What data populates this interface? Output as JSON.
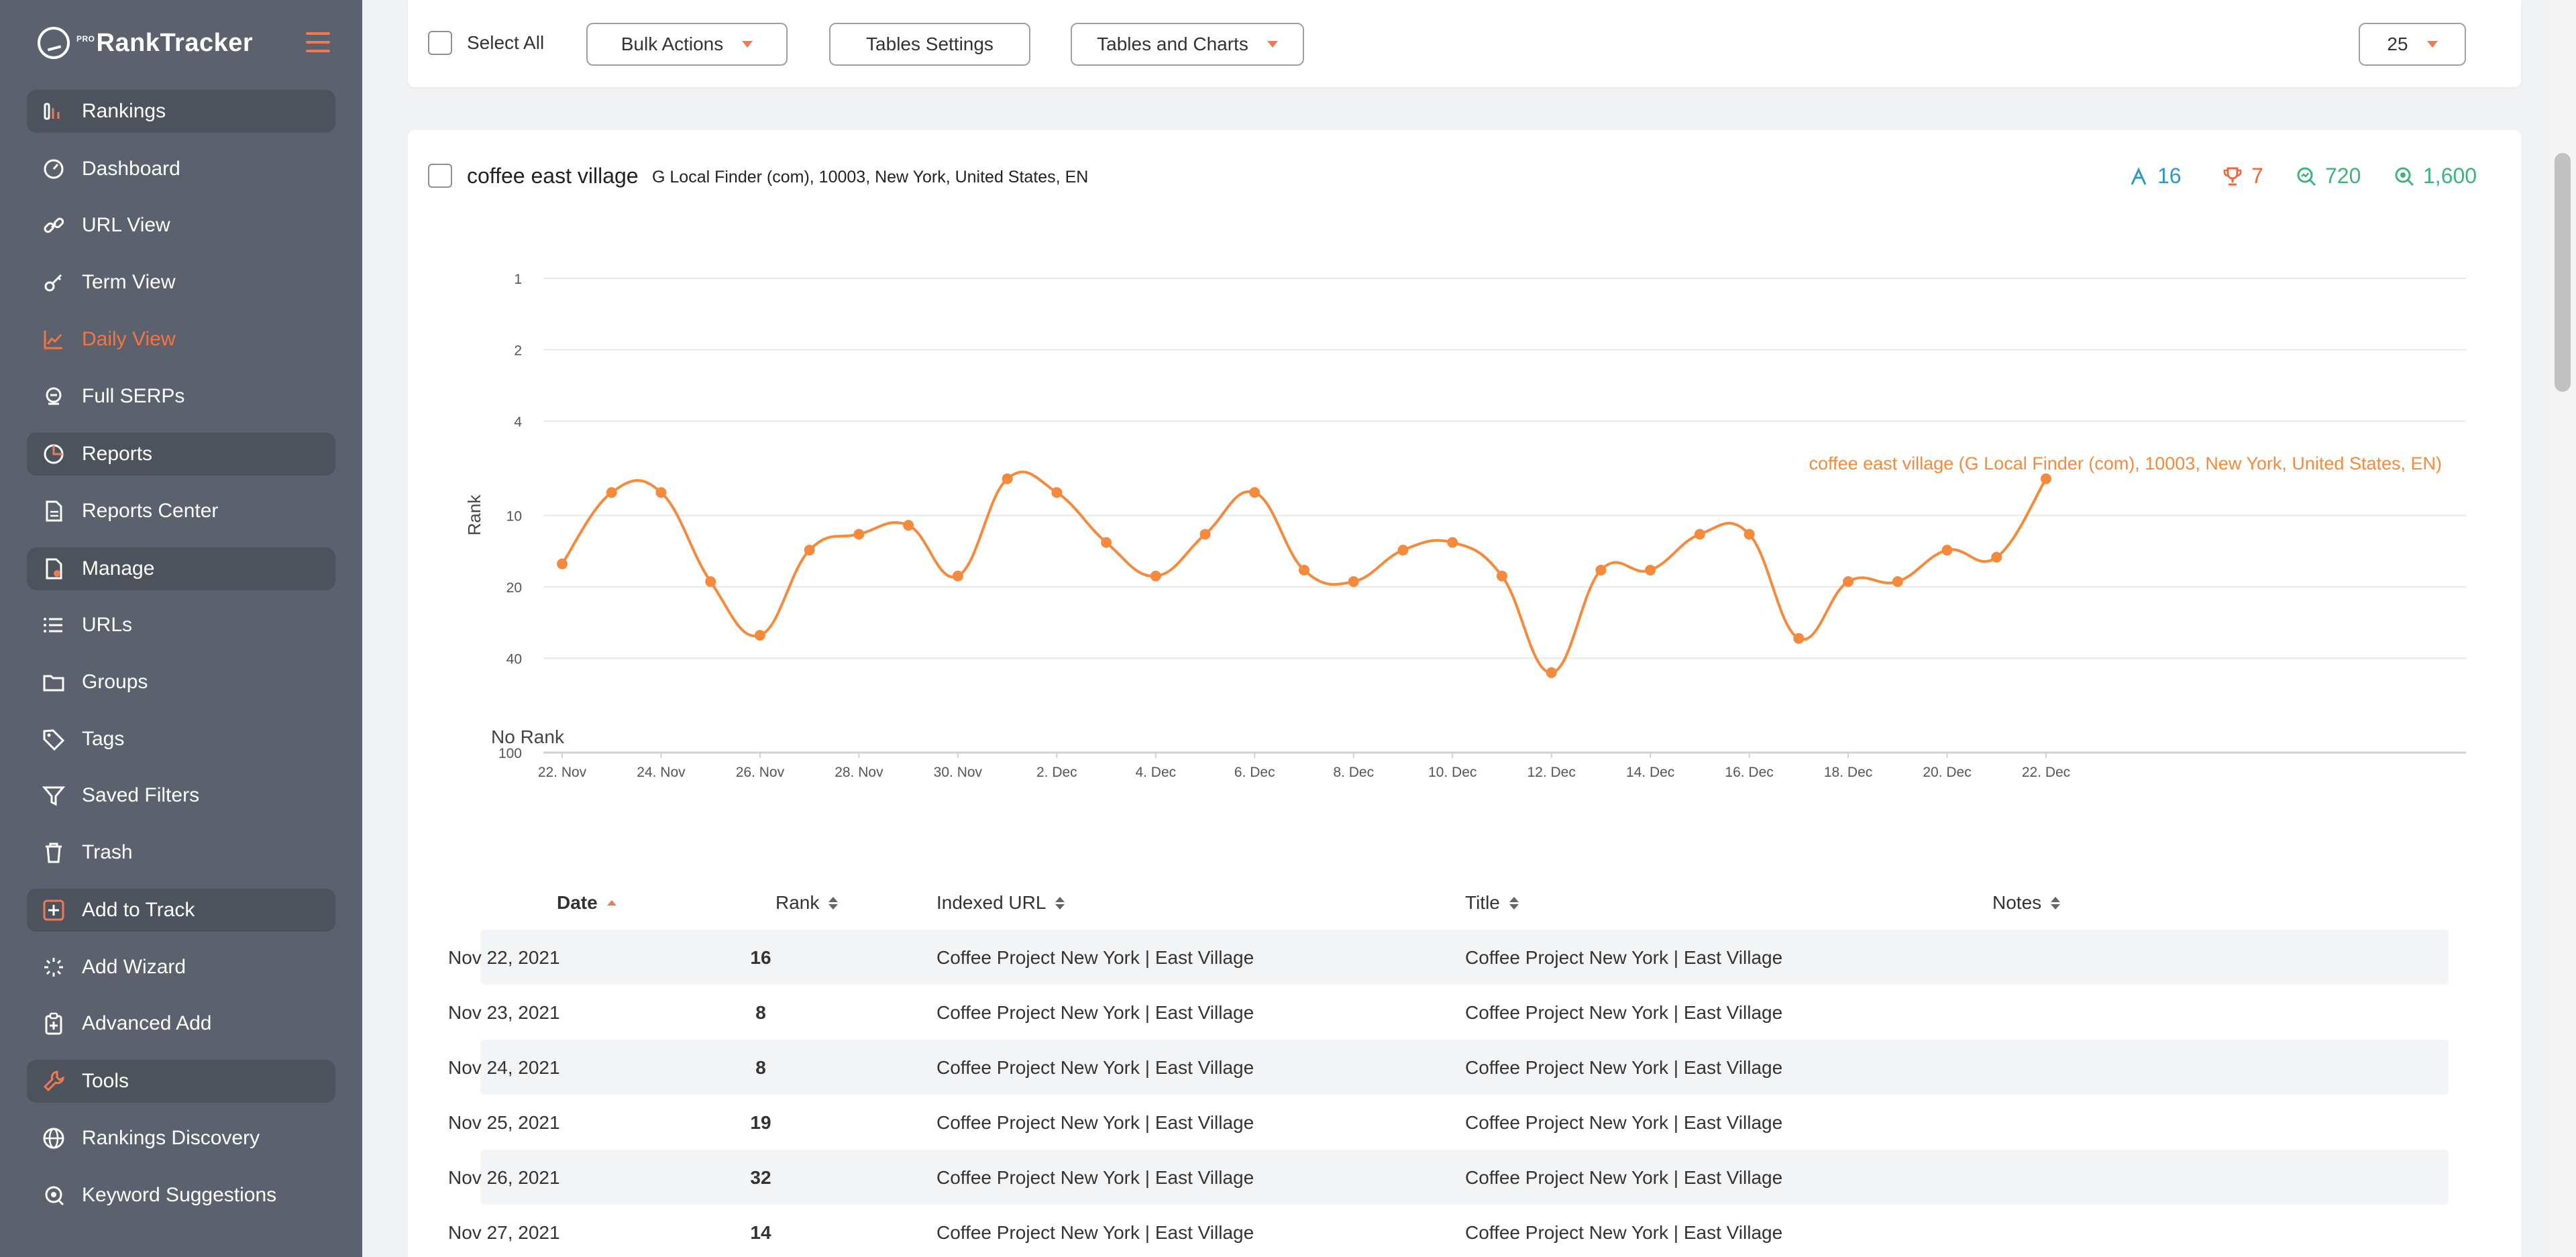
{
  "app": {
    "logo_text": "RankTracker",
    "logo_prefix": "PRO"
  },
  "colors": {
    "accent": "#f07a52",
    "sidebar_bg": "#5b626d",
    "series": "#f58a3c",
    "stat_blue": "#2a9bc3",
    "stat_red": "#f0663a",
    "stat_green": "#3fb37c"
  },
  "sidebar": {
    "items": [
      {
        "label": "Rankings",
        "icon": "rankings-icon",
        "section": true
      },
      {
        "label": "Dashboard",
        "icon": "gauge-icon"
      },
      {
        "label": "URL View",
        "icon": "link-icon"
      },
      {
        "label": "Term View",
        "icon": "key-icon"
      },
      {
        "label": "Daily View",
        "icon": "line-chart-icon",
        "active": true
      },
      {
        "label": "Full SERPs",
        "icon": "serp-icon"
      },
      {
        "label": "Reports",
        "icon": "pie-chart-icon",
        "section": true
      },
      {
        "label": "Reports Center",
        "icon": "document-icon"
      },
      {
        "label": "Manage",
        "icon": "manage-icon",
        "section": true
      },
      {
        "label": "URLs",
        "icon": "list-icon"
      },
      {
        "label": "Groups",
        "icon": "folder-icon"
      },
      {
        "label": "Tags",
        "icon": "tag-icon"
      },
      {
        "label": "Saved Filters",
        "icon": "filter-icon"
      },
      {
        "label": "Trash",
        "icon": "trash-icon"
      },
      {
        "label": "Add to Track",
        "icon": "plus-square-icon",
        "section": true
      },
      {
        "label": "Add Wizard",
        "icon": "wizard-icon"
      },
      {
        "label": "Advanced Add",
        "icon": "clipboard-plus-icon"
      },
      {
        "label": "Tools",
        "icon": "wrench-icon",
        "section": true
      },
      {
        "label": "Rankings Discovery",
        "icon": "globe-icon"
      },
      {
        "label": "Keyword Suggestions",
        "icon": "search-icon"
      }
    ]
  },
  "toolbar": {
    "select_all": "Select All",
    "bulk_actions": "Bulk Actions",
    "tables_settings": "Tables Settings",
    "tables_and_charts": "Tables and Charts",
    "per_page": "25"
  },
  "keyword": {
    "title": "coffee east village",
    "detail": "G Local Finder (com), 10003, New York, United States, EN",
    "stats": [
      {
        "icon": "rank-icon",
        "value": "16",
        "color": "#2a9bc3"
      },
      {
        "icon": "trophy-icon",
        "value": "7",
        "color": "#f0663a"
      },
      {
        "icon": "search-volume-icon",
        "value": "720",
        "color": "#3fb37c"
      },
      {
        "icon": "search-results-icon",
        "value": "1,600",
        "color": "#3fb37c"
      }
    ]
  },
  "chart_data": {
    "type": "line",
    "ylabel": "Rank",
    "no_rank_label": "No Rank",
    "y_scale": "log (inverted)",
    "y_ticks": [
      "1",
      "2",
      "4",
      "10",
      "20",
      "40",
      "100"
    ],
    "x_tick_labels": [
      "22. Nov",
      "24. Nov",
      "26. Nov",
      "28. Nov",
      "30. Nov",
      "2. Dec",
      "4. Dec",
      "6. Dec",
      "8. Dec",
      "10. Dec",
      "12. Dec",
      "14. Dec",
      "16. Dec",
      "18. Dec",
      "20. Dec",
      "22. Dec"
    ],
    "x": [
      "2021-11-22",
      "2021-11-23",
      "2021-11-24",
      "2021-11-25",
      "2021-11-26",
      "2021-11-27",
      "2021-11-28",
      "2021-11-29",
      "2021-11-30",
      "2021-12-01",
      "2021-12-02",
      "2021-12-03",
      "2021-12-04",
      "2021-12-05",
      "2021-12-06",
      "2021-12-07",
      "2021-12-08",
      "2021-12-09",
      "2021-12-10",
      "2021-12-11",
      "2021-12-12",
      "2021-12-13",
      "2021-12-14",
      "2021-12-15",
      "2021-12-16",
      "2021-12-17",
      "2021-12-18",
      "2021-12-19",
      "2021-12-20",
      "2021-12-21",
      "2021-12-22"
    ],
    "series": [
      {
        "name": "coffee east village (G Local Finder (com), 10003, New York, United States, EN)",
        "values": [
          16,
          8,
          8,
          19,
          32,
          14,
          12,
          11,
          18,
          7,
          8,
          13,
          18,
          12,
          8,
          17,
          19,
          14,
          13,
          18,
          46,
          17,
          17,
          12,
          12,
          33,
          19,
          19,
          14,
          15,
          7
        ]
      }
    ],
    "grid": true,
    "legend": "series label at right end of line"
  },
  "table": {
    "headers": {
      "date": "Date",
      "rank": "Rank",
      "url": "Indexed URL",
      "title": "Title",
      "notes": "Notes"
    },
    "rows": [
      {
        "date": "Nov 22, 2021",
        "rank": "16",
        "url": "Coffee Project New York | East Village",
        "title": "Coffee Project New York | East Village",
        "notes": ""
      },
      {
        "date": "Nov 23, 2021",
        "rank": "8",
        "url": "Coffee Project New York | East Village",
        "title": "Coffee Project New York | East Village",
        "notes": ""
      },
      {
        "date": "Nov 24, 2021",
        "rank": "8",
        "url": "Coffee Project New York | East Village",
        "title": "Coffee Project New York | East Village",
        "notes": ""
      },
      {
        "date": "Nov 25, 2021",
        "rank": "19",
        "url": "Coffee Project New York | East Village",
        "title": "Coffee Project New York | East Village",
        "notes": ""
      },
      {
        "date": "Nov 26, 2021",
        "rank": "32",
        "url": "Coffee Project New York | East Village",
        "title": "Coffee Project New York | East Village",
        "notes": ""
      },
      {
        "date": "Nov 27, 2021",
        "rank": "14",
        "url": "Coffee Project New York | East Village",
        "title": "Coffee Project New York | East Village",
        "notes": ""
      }
    ]
  }
}
